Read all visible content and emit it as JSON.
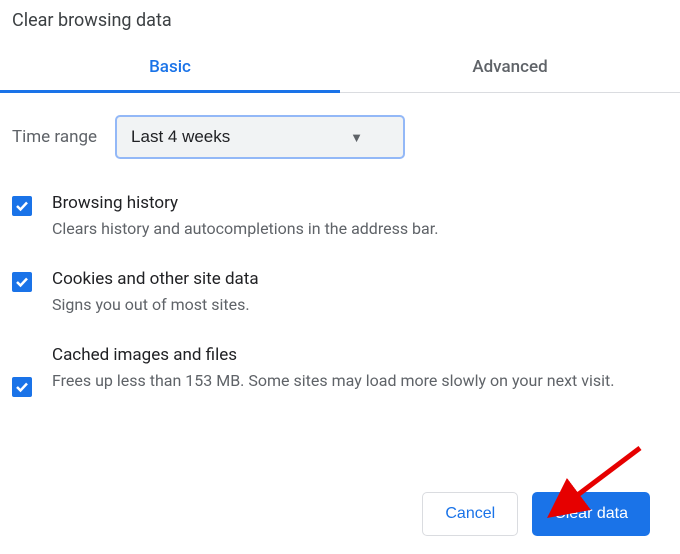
{
  "dialog": {
    "title": "Clear browsing data"
  },
  "tabs": {
    "basic": "Basic",
    "advanced": "Advanced"
  },
  "time_range": {
    "label": "Time range",
    "value": "Last 4 weeks"
  },
  "options": [
    {
      "title": "Browsing history",
      "description": "Clears history and autocompletions in the address bar.",
      "checked": true
    },
    {
      "title": "Cookies and other site data",
      "description": "Signs you out of most sites.",
      "checked": true
    },
    {
      "title": "Cached images and files",
      "description": "Frees up less than 153 MB. Some sites may load more slowly on your next visit.",
      "checked": true
    }
  ],
  "buttons": {
    "cancel": "Cancel",
    "clear": "Clear data"
  }
}
